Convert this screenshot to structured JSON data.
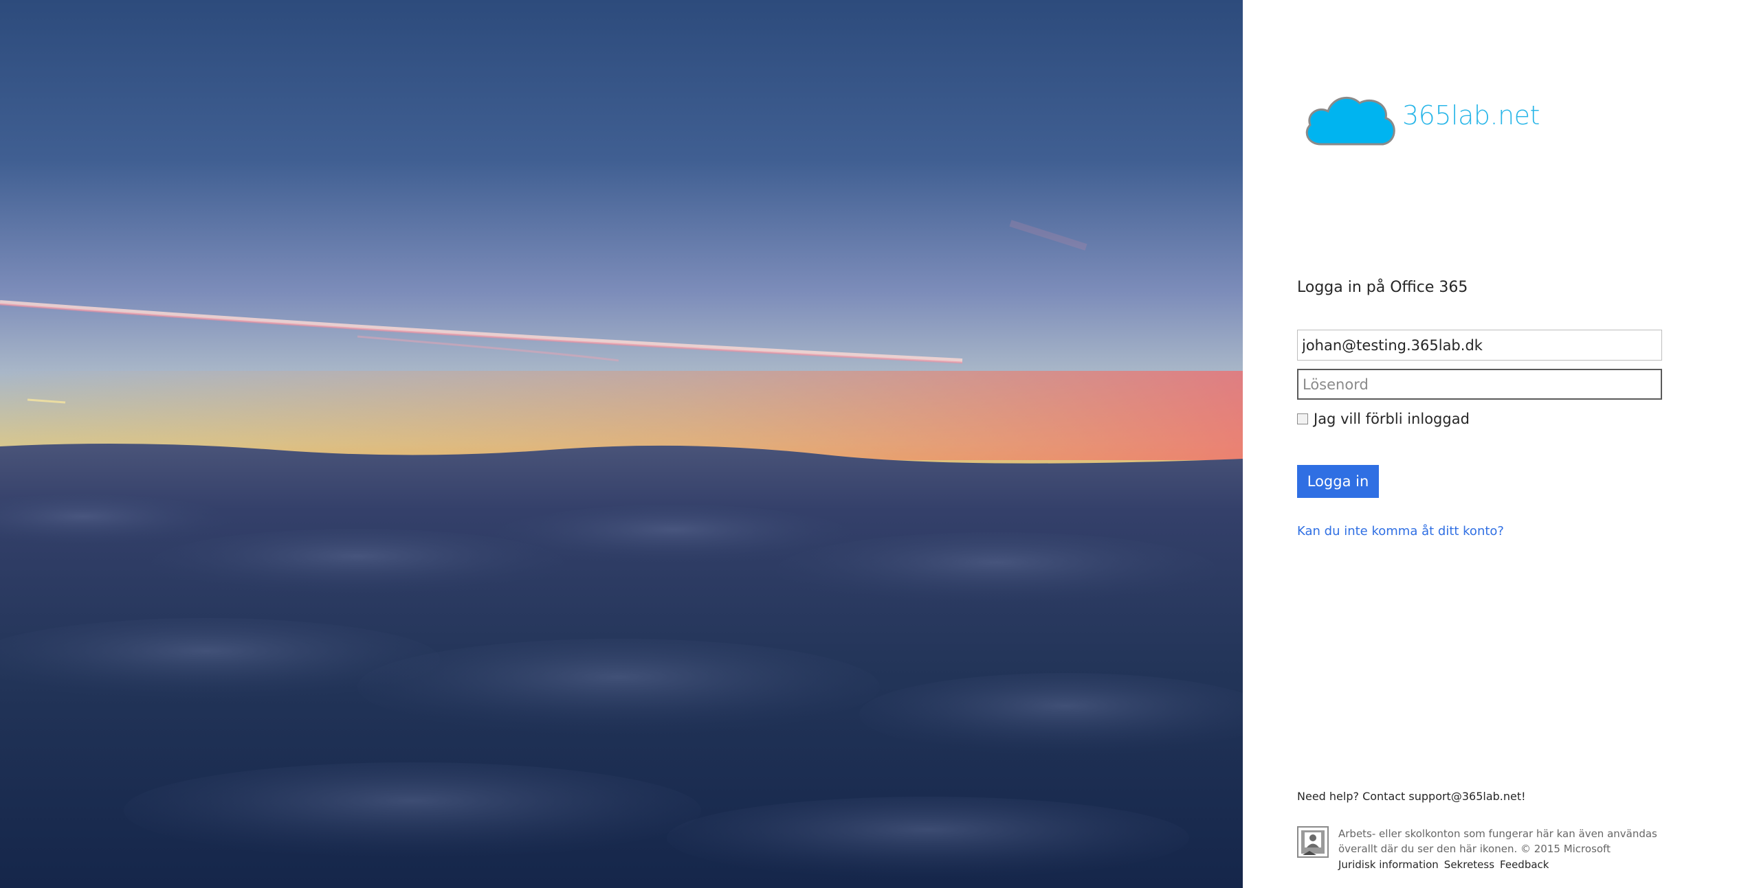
{
  "background": {
    "sky_top": "#2e4f80",
    "sky_mid": "#7e8db8",
    "horizon_warm": "#f4b64c",
    "horizon_pink": "#f07a68",
    "clouds": "#1a2d4f"
  },
  "logo": {
    "icon": "cloud-icon",
    "text": "365lab.net",
    "color": "#29b6e8"
  },
  "signin": {
    "heading": "Logga in på Office 365",
    "email_value": "johan@testing.365lab.dk",
    "password_placeholder": "Lösenord",
    "remember_label": "Jag vill förbli inloggad",
    "remember_checked": false,
    "submit_label": "Logga in",
    "cant_access_link": "Kan du inte komma åt ditt konto?",
    "accent": "#2f6fe3"
  },
  "help": {
    "text": "Need help? Contact support@365lab.net!"
  },
  "footer": {
    "icon": "work-account-badge-icon",
    "description": "Arbets- eller skolkonton som fungerar här kan även användas överallt där du ser den här ikonen. © 2015 Microsoft",
    "links": [
      {
        "label": "Juridisk information"
      },
      {
        "label": "Sekretess"
      },
      {
        "label": "Feedback"
      }
    ]
  }
}
